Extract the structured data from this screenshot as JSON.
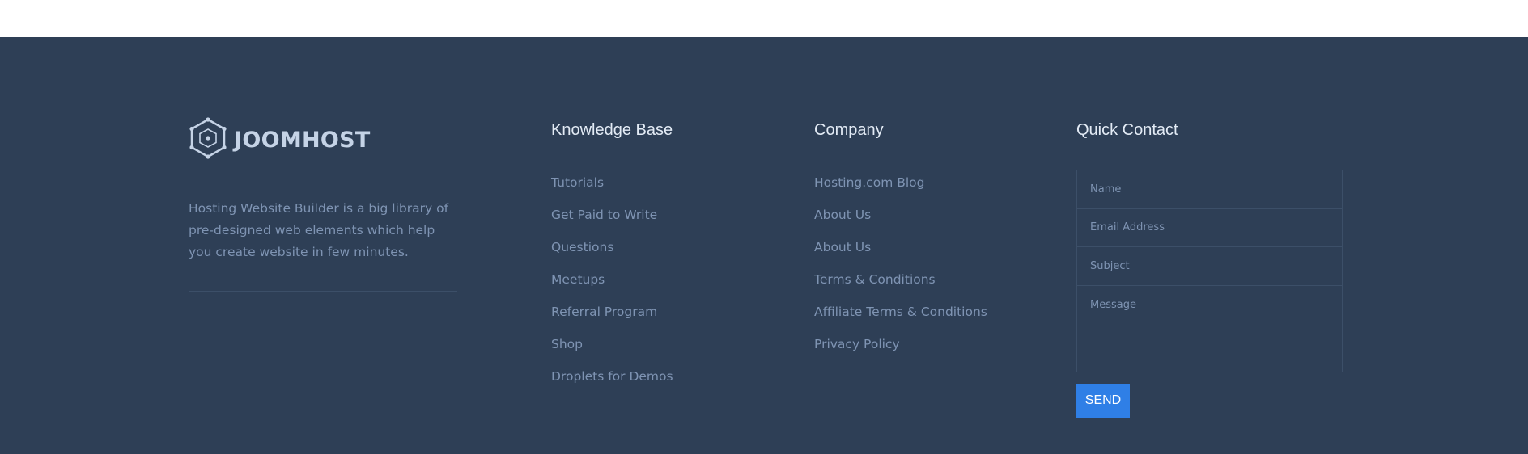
{
  "brand": {
    "name": "JOOMHOST",
    "description": "Hosting Website Builder is a big library of pre-designed web elements which help you create website in few minutes."
  },
  "knowledge_base": {
    "title": "Knowledge Base",
    "links": [
      "Tutorials",
      "Get Paid to Write",
      "Questions",
      "Meetups",
      "Referral Program",
      "Shop",
      "Droplets for Demos"
    ]
  },
  "company": {
    "title": "Company",
    "links": [
      "Hosting.com Blog",
      "About Us",
      "About Us",
      "Terms & Conditions",
      "Affiliate Terms & Conditions",
      "Privacy Policy"
    ]
  },
  "quick_contact": {
    "title": "Quick Contact",
    "name_placeholder": "Name",
    "email_placeholder": "Email Address",
    "subject_placeholder": "Subject",
    "message_placeholder": "Message",
    "send_label": "SEND"
  },
  "colors": {
    "footer_bg": "#2e3f56",
    "heading": "#e3ebf5",
    "link": "#7f94b3",
    "accent": "#2f7fe6"
  },
  "icons": {
    "logo": "hexagon-logo-icon"
  }
}
